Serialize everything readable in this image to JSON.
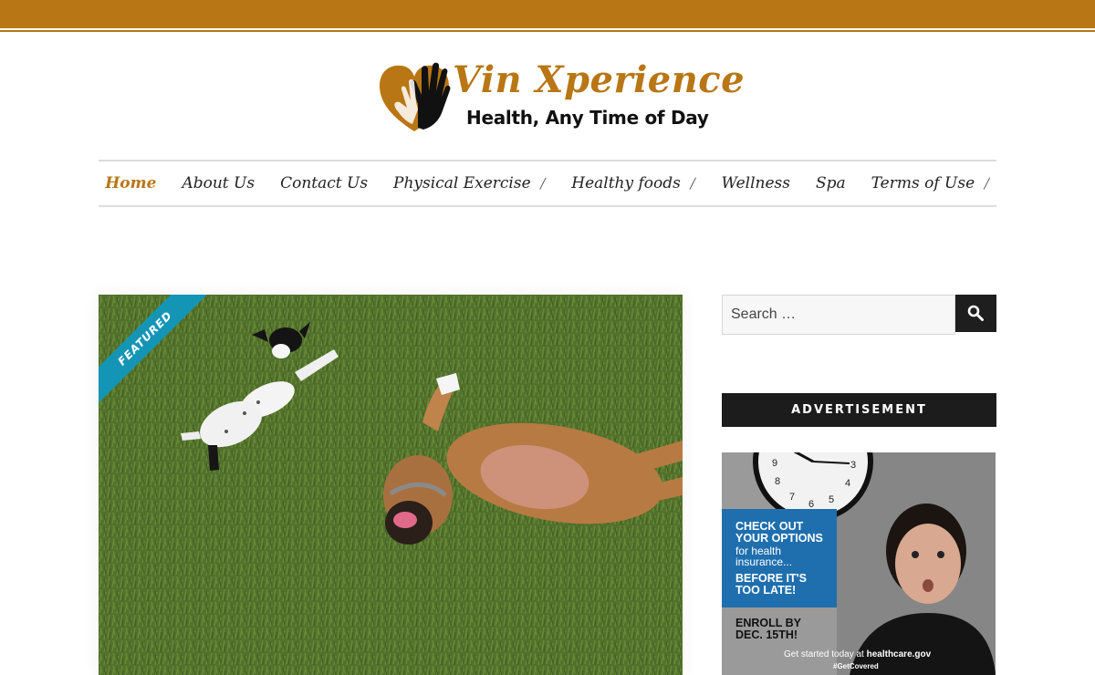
{
  "brand": {
    "title": "Vin Xperience",
    "tagline": "Health, Any Time of Day",
    "color": "#b97615"
  },
  "nav": {
    "items": [
      {
        "label": "Home",
        "active": true,
        "has_submenu": false
      },
      {
        "label": "About Us",
        "active": false,
        "has_submenu": false
      },
      {
        "label": "Contact Us",
        "active": false,
        "has_submenu": false
      },
      {
        "label": "Physical Exercise",
        "active": false,
        "has_submenu": true
      },
      {
        "label": "Healthy foods",
        "active": false,
        "has_submenu": true
      },
      {
        "label": "Wellness",
        "active": false,
        "has_submenu": false
      },
      {
        "label": "Spa",
        "active": false,
        "has_submenu": false
      },
      {
        "label": "Terms of Use",
        "active": false,
        "has_submenu": true
      }
    ]
  },
  "featured": {
    "badge": "FEATURED",
    "badge_color": "#1595b6",
    "image_icon": "dogs-on-grass-photo"
  },
  "search": {
    "placeholder": "Search …",
    "button_icon": "search-icon"
  },
  "sidebar": {
    "ad_heading": "ADVERTISEMENT"
  },
  "ad": {
    "check_lines": "CHECK OUT\nYOUR OPTIONS",
    "sub_lines": "for health\ninsurance...",
    "late_lines": "BEFORE IT'S\nTOO LATE!",
    "enroll_lines": "ENROLL BY\nDEC. 15TH!",
    "get_started": "Get started today at",
    "site": "healthcare.gov",
    "hashtag": "#GetCovered",
    "clock_numbers": [
      "9",
      "3",
      "8",
      "4",
      "7",
      "6",
      "5"
    ]
  }
}
